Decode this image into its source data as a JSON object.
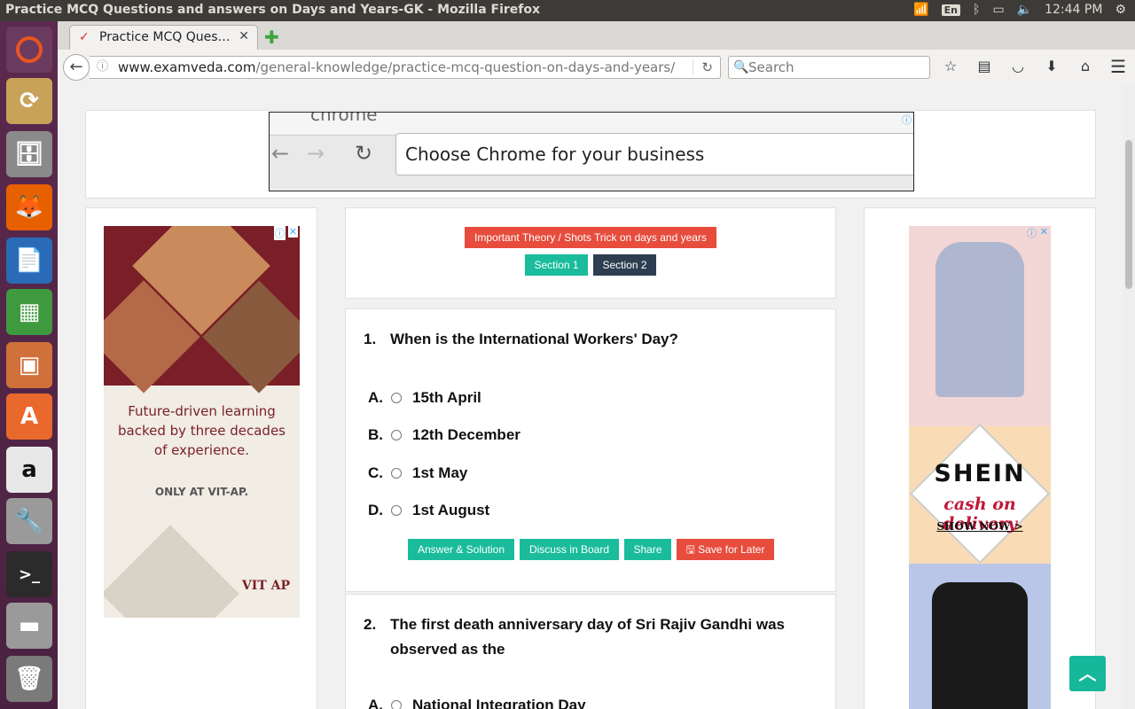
{
  "os": {
    "window_title": "Practice MCQ Questions and answers on Days and Years-GK - Mozilla Firefox",
    "keyboard_layout": "En",
    "clock": "12:44 PM"
  },
  "browser": {
    "tab_title": "Practice MCQ Ques…",
    "url_domain": "www.examveda.com",
    "url_path": "/general-knowledge/practice-mcq-question-on-days-and-years/",
    "search_placeholder": "Search"
  },
  "top_ad": {
    "brand_fragment": "chrome",
    "headline": "Choose Chrome for your business"
  },
  "left_ad": {
    "tagline": "Future-driven learning backed by three decades of experience.",
    "subtag": "ONLY AT VIT-AP.",
    "logo_text": "VIT AP"
  },
  "right_ad": {
    "brand": "SHEIN",
    "promo": "cash on delivery",
    "cta": "SHOW NOW >"
  },
  "sections": {
    "theory_button": "Important Theory / Shots Trick on days and years",
    "section1": "Section 1",
    "section2": "Section 2"
  },
  "questions": [
    {
      "number": "1.",
      "text": "When is the International Workers' Day?",
      "options": [
        {
          "letter": "A.",
          "text": "15th April"
        },
        {
          "letter": "B.",
          "text": "12th December"
        },
        {
          "letter": "C.",
          "text": "1st May"
        },
        {
          "letter": "D.",
          "text": "1st August"
        }
      ],
      "actions": {
        "answer": "Answer & Solution",
        "discuss": "Discuss in Board",
        "share": "Share",
        "save": "Save for Later"
      }
    },
    {
      "number": "2.",
      "text": "The first death anniversary day of Sri Rajiv Gandhi was observed as the",
      "options": [
        {
          "letter": "A.",
          "text": "National Integration Day"
        }
      ]
    }
  ],
  "colors": {
    "accent_green": "#1abc9c",
    "accent_red": "#e74c3c",
    "dark": "#2c3e50",
    "launcher": "#5b2a4e"
  }
}
